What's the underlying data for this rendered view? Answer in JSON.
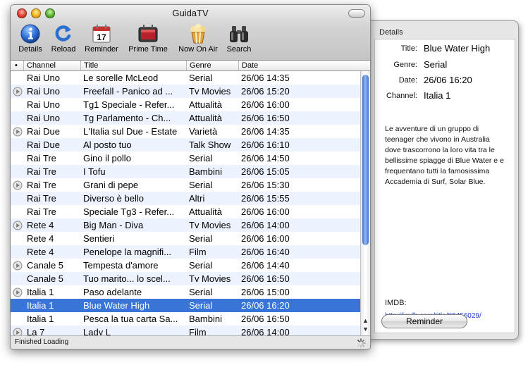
{
  "window": {
    "title": "GuidaTV"
  },
  "toolbar": [
    {
      "label": "Details",
      "icon": "info-icon"
    },
    {
      "label": "Reload",
      "icon": "reload-icon"
    },
    {
      "label": "Reminder",
      "icon": "calendar-icon"
    },
    {
      "label": "Prime Time",
      "icon": "tv-icon"
    },
    {
      "label": "Now On Air",
      "icon": "popcorn-icon"
    },
    {
      "label": "Search",
      "icon": "binoculars-icon"
    }
  ],
  "table": {
    "columns": [
      "•",
      "Channel",
      "Title",
      "Genre",
      "Date"
    ],
    "rows": [
      {
        "playing": false,
        "channel": "Rai Uno",
        "title": "Le sorelle McLeod",
        "genre": "Serial",
        "date": "26/06 14:35"
      },
      {
        "playing": true,
        "channel": "Rai Uno",
        "title": "Freefall - Panico ad ...",
        "genre": "Tv Movies",
        "date": "26/06 15:20"
      },
      {
        "playing": false,
        "channel": "Rai Uno",
        "title": "Tg1 Speciale - Refer...",
        "genre": "Attualità",
        "date": "26/06 16:00"
      },
      {
        "playing": false,
        "channel": "Rai Uno",
        "title": "Tg Parlamento - Ch...",
        "genre": "Attualità",
        "date": "26/06 16:50"
      },
      {
        "playing": true,
        "channel": "Rai Due",
        "title": "L'Italia sul Due - Estate",
        "genre": "Varietà",
        "date": "26/06 14:35"
      },
      {
        "playing": false,
        "channel": "Rai Due",
        "title": "Al posto tuo",
        "genre": "Talk Show",
        "date": "26/06 16:10"
      },
      {
        "playing": false,
        "channel": "Rai Tre",
        "title": "Gino il pollo",
        "genre": "Serial",
        "date": "26/06 14:50"
      },
      {
        "playing": false,
        "channel": "Rai Tre",
        "title": "I Tofu",
        "genre": "Bambini",
        "date": "26/06 15:05"
      },
      {
        "playing": true,
        "channel": "Rai Tre",
        "title": "Grani di pepe",
        "genre": "Serial",
        "date": "26/06 15:30"
      },
      {
        "playing": false,
        "channel": "Rai Tre",
        "title": "Diverso è bello",
        "genre": "Altri",
        "date": "26/06 15:55"
      },
      {
        "playing": false,
        "channel": "Rai Tre",
        "title": "Speciale Tg3 - Refer...",
        "genre": "Attualità",
        "date": "26/06 16:00"
      },
      {
        "playing": true,
        "channel": "Rete 4",
        "title": "Big Man - Diva",
        "genre": "Tv Movies",
        "date": "26/06 14:00"
      },
      {
        "playing": false,
        "channel": "Rete 4",
        "title": "Sentieri",
        "genre": "Serial",
        "date": "26/06 16:00"
      },
      {
        "playing": false,
        "channel": "Rete 4",
        "title": "Penelope la magnifi...",
        "genre": "Film",
        "date": "26/06 16:40"
      },
      {
        "playing": true,
        "channel": "Canale 5",
        "title": "Tempesta d'amore",
        "genre": "Serial",
        "date": "26/06 14:40"
      },
      {
        "playing": false,
        "channel": "Canale 5",
        "title": "Tuo marito... lo scel...",
        "genre": "Tv Movies",
        "date": "26/06 16:50"
      },
      {
        "playing": true,
        "channel": "Italia 1",
        "title": "Paso adelante",
        "genre": "Serial",
        "date": "26/06 15:00"
      },
      {
        "playing": false,
        "channel": "Italia 1",
        "title": "Blue Water High",
        "genre": "Serial",
        "date": "26/06 16:20",
        "selected": true
      },
      {
        "playing": false,
        "channel": "Italia 1",
        "title": "Pesca la tua carta Sa...",
        "genre": "Bambini",
        "date": "26/06 16:50"
      },
      {
        "playing": true,
        "channel": "La 7",
        "title": "Lady L",
        "genre": "Film",
        "date": "26/06 14:00"
      }
    ]
  },
  "status": {
    "text": "Finished Loading"
  },
  "details": {
    "header": "Details",
    "title_label": "Title:",
    "title": "Blue Water High",
    "genre_label": "Genre:",
    "genre": "Serial",
    "date_label": "Date:",
    "date": "26/06 16:20",
    "channel_label": "Channel:",
    "channel": "Italia 1",
    "description": "Le avventure di un gruppo di teenager che vivono in Australia dove trascorrono la loro vita tra le bellissime spiagge di Blue Water e e frequentano tutti la famosissima Accademia di Surf, Solar Blue.",
    "imdb_label": "IMDB:",
    "imdb_link": "http://imdb.com/title/tt0456029/",
    "reminder_button": "Reminder"
  },
  "colors": {
    "selection": "#3875d7",
    "alt_row": "#edf3fe",
    "link": "#1a3fc7"
  }
}
